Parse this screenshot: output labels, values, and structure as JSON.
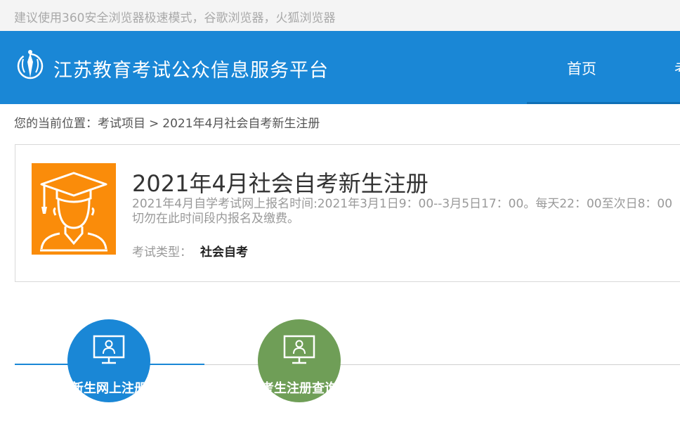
{
  "notice": {
    "text": "建议使用360安全浏览器极速模式，谷歌浏览器，火狐浏览器"
  },
  "header": {
    "title": "江苏教育考试公众信息服务平台",
    "nav": [
      {
        "label": "首页"
      },
      {
        "label": "考"
      }
    ]
  },
  "breadcrumb": {
    "prefix": "您的当前位置：",
    "items": [
      "考试项目",
      "2021年4月社会自考新生注册"
    ],
    "separator": ">"
  },
  "exam": {
    "title": "2021年4月社会自考新生注册",
    "description_line1": "2021年4月自学考试网上报名时间:2021年3月1日9：00--3月5日17：00。每天22：00至次日8：00",
    "description_line2": "切勿在此时间段内报名及缴费。",
    "type_label": "考试类型：",
    "type_value": "社会自考"
  },
  "steps": [
    {
      "label": "新生网上注册",
      "color": "#1a87d6",
      "icon": "monitor-user-icon"
    },
    {
      "label": "考生注册查询",
      "color": "#6f9e57",
      "icon": "monitor-user-icon"
    }
  ],
  "colors": {
    "brand": "#1a87d6",
    "exam_icon_bg": "#fa8c0a",
    "step2": "#6f9e57"
  }
}
